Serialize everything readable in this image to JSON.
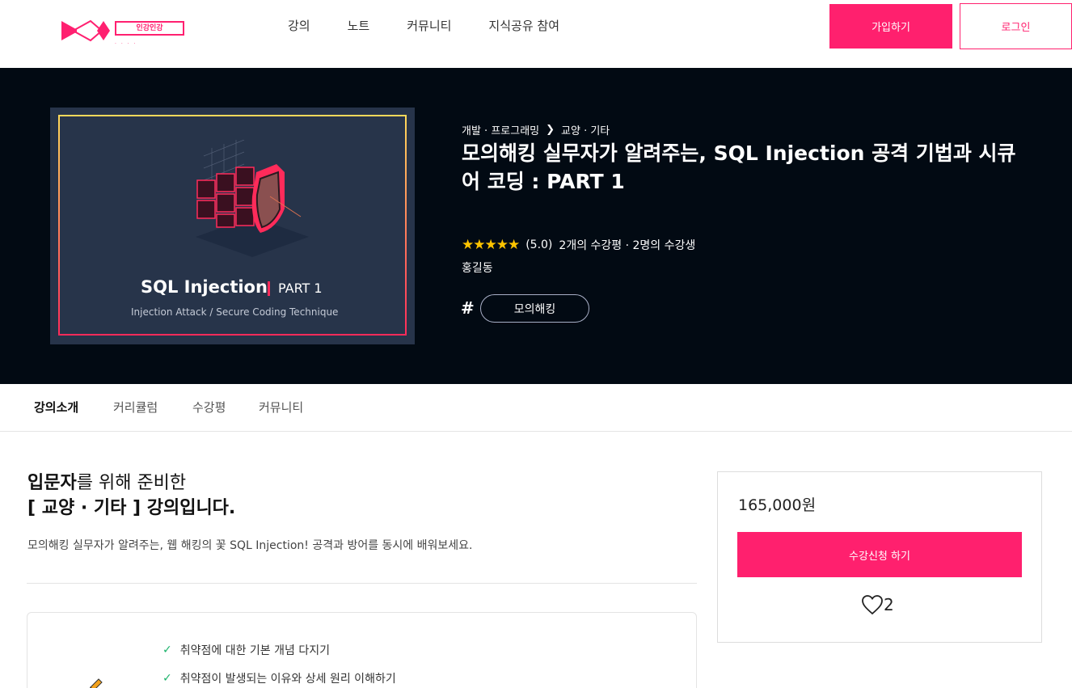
{
  "header": {
    "logo_text": "인강인강",
    "logo_sub": "· · · ·",
    "nav": [
      "강의",
      "노트",
      "커뮤니티",
      "지식공유 참여"
    ],
    "signup_label": "가입하기",
    "login_label": "로그인"
  },
  "hero": {
    "thumbnail": {
      "title": "SQL Injection",
      "part": "PART 1",
      "subtitle": "Injection Attack / Secure Coding Technique"
    },
    "breadcrumb": [
      "개발 · 프로그래밍",
      "교양 · 기타"
    ],
    "breadcrumb_sep": "❯",
    "title": "모의해킹 실무자가 알려주는, SQL Injection 공격 기법과 시큐어 코딩 : PART 1",
    "stars": "★★★★★",
    "rating": "(5.0)",
    "reviews": "2개의 수강평 · 2명의 수강생",
    "instructor": "홍길동",
    "hash": "#",
    "tag": "모의해킹"
  },
  "tabs": [
    "강의소개",
    "커리큘럼",
    "수강평",
    "커뮤니티"
  ],
  "intro": {
    "line1_bold": "입문자",
    "line1_rest": "를 위해 준비한",
    "line2": "[ 교양 · 기타 ] 강의입니다.",
    "desc": "모의해킹 실무자가 알려주는, 웹 해킹의 꽃 SQL Injection! 공격과 방어를 동시에 배워보세요."
  },
  "learn": {
    "items": [
      "취약점에 대한 기본 개념 다지기",
      "취약점이 발생되는 이유와 상세 원리 이해하기"
    ],
    "check_icon": "✓"
  },
  "card": {
    "price": "165,000원",
    "enroll_label": "수강신청 하기",
    "likes": "2"
  },
  "colors": {
    "brand": "#ff206e",
    "hero_bg": "#020a13",
    "star": "#ffc400",
    "check": "#1cb36b"
  }
}
